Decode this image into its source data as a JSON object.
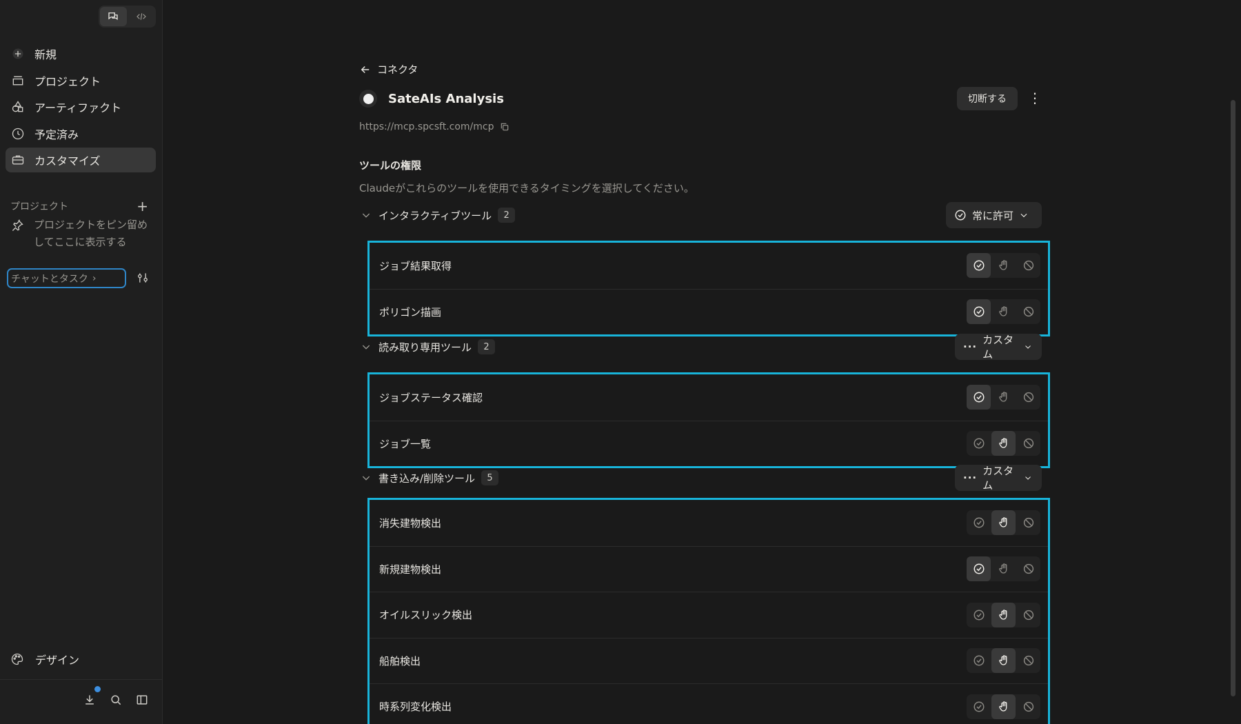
{
  "sidebar": {
    "nav": [
      {
        "label": "新規",
        "icon": "plus-icon"
      },
      {
        "label": "プロジェクト",
        "icon": "folder-icon"
      },
      {
        "label": "アーティファクト",
        "icon": "shapes-icon"
      },
      {
        "label": "予定済み",
        "icon": "clock-icon"
      },
      {
        "label": "カスタマイズ",
        "icon": "briefcase-icon",
        "active": true
      }
    ],
    "projects_heading": "プロジェクト",
    "pin_note": "プロジェクトをピン留めしてここに表示する",
    "chat_task": "チャットとタスク",
    "design_label": "デザイン"
  },
  "main": {
    "back_label": "コネクタ",
    "title": "SateAIs Analysis",
    "disconnect_label": "切断する",
    "url": "https://mcp.spcsft.com/mcp",
    "section_title": "ツールの権限",
    "section_desc": "Claudeがこれらのツールを使用できるタイミングを選択してください。",
    "groups": [
      {
        "name": "インタラクティブツール",
        "count": "2",
        "select_label": "常に許可",
        "select_icon": "check-circle-icon",
        "tools": [
          {
            "name": "ジョブ結果取得",
            "state": "allow"
          },
          {
            "name": "ポリゴン描画",
            "state": "allow"
          }
        ]
      },
      {
        "name": "読み取り専用ツール",
        "count": "2",
        "select_label": "カスタム",
        "select_icon": "more-icon",
        "tools": [
          {
            "name": "ジョブステータス確認",
            "state": "allow"
          },
          {
            "name": "ジョブ一覧",
            "state": "ask"
          }
        ]
      },
      {
        "name": "書き込み/削除ツール",
        "count": "5",
        "select_label": "カスタム",
        "select_icon": "more-icon",
        "tools": [
          {
            "name": "消失建物検出",
            "state": "ask"
          },
          {
            "name": "新規建物検出",
            "state": "allow"
          },
          {
            "name": "オイルスリック検出",
            "state": "ask"
          },
          {
            "name": "船舶検出",
            "state": "ask"
          },
          {
            "name": "時系列変化検出",
            "state": "ask"
          }
        ]
      }
    ]
  },
  "colors": {
    "highlight_border": "#18b4da",
    "background": "#1a1a1a",
    "sidebar": "#1f1f1f"
  }
}
